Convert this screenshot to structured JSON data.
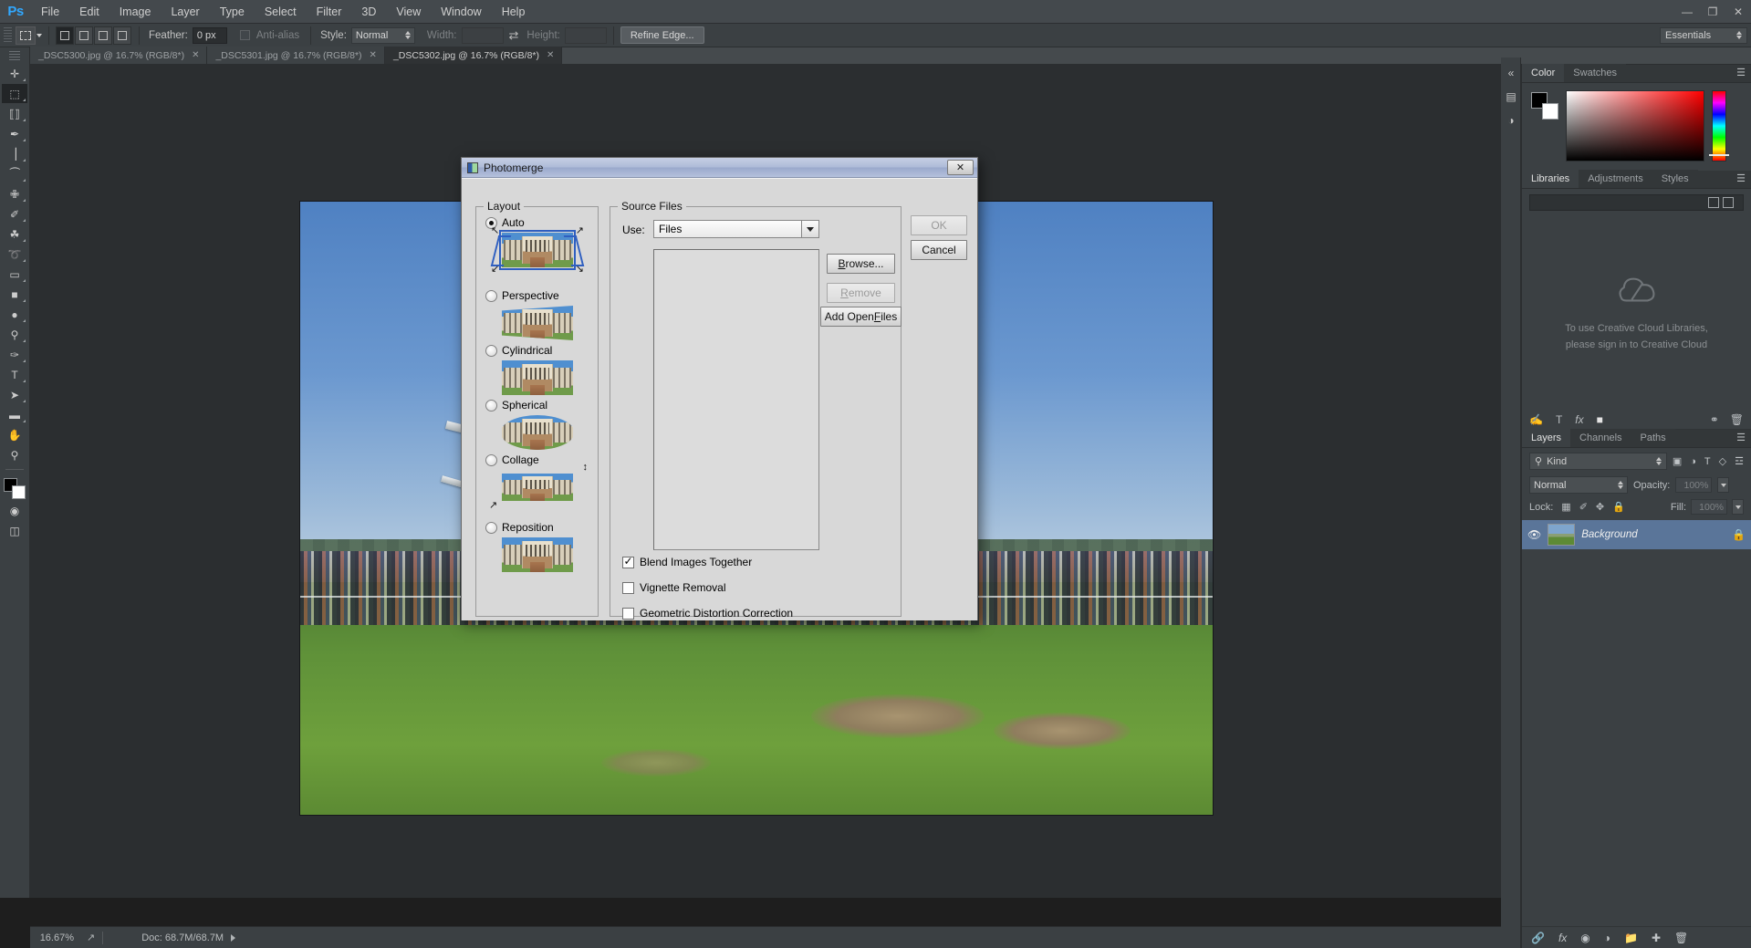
{
  "app": {
    "name": "Ps",
    "logo_color": "#31a8ff"
  },
  "menubar": {
    "items": [
      "File",
      "Edit",
      "Image",
      "Layer",
      "Type",
      "Select",
      "Filter",
      "3D",
      "View",
      "Window",
      "Help"
    ],
    "window_buttons": {
      "minimize": "—",
      "restore": "❐",
      "close": "✕"
    }
  },
  "options_bar": {
    "feather_label": "Feather:",
    "feather_value": "0 px",
    "antialias_label": "Anti-alias",
    "style_label": "Style:",
    "style_value": "Normal",
    "width_label": "Width:",
    "width_value": "",
    "height_label": "Height:",
    "height_value": "",
    "refine_edge_label": "Refine Edge...",
    "workspace_label": "Essentials"
  },
  "tabs": [
    {
      "title": "_DSC5300.jpg @ 16.7% (RGB/8*)",
      "active": false,
      "close": "✕"
    },
    {
      "title": "_DSC5301.jpg @ 16.7% (RGB/8*)",
      "active": false,
      "close": "✕"
    },
    {
      "title": "_DSC5302.jpg @ 16.7% (RGB/8*)",
      "active": true,
      "close": "✕"
    }
  ],
  "toolbar": {
    "tools": [
      {
        "name": "move-tool",
        "glyph": "✛"
      },
      {
        "name": "rectangular-marquee-tool",
        "glyph": "⬚",
        "selected": true
      },
      {
        "name": "lasso-tool",
        "glyph": "❦"
      },
      {
        "name": "quick-selection-tool",
        "glyph": "✒"
      },
      {
        "name": "crop-tool",
        "glyph": "⌗"
      },
      {
        "name": "eyedropper-tool",
        "glyph": "⚗"
      },
      {
        "name": "spot-healing-brush-tool",
        "glyph": "✙"
      },
      {
        "name": "brush-tool",
        "glyph": "✐"
      },
      {
        "name": "clone-stamp-tool",
        "glyph": "⛏"
      },
      {
        "name": "history-brush-tool",
        "glyph": "➰"
      },
      {
        "name": "eraser-tool",
        "glyph": "▭"
      },
      {
        "name": "gradient-tool",
        "glyph": "■"
      },
      {
        "name": "blur-tool",
        "glyph": "●"
      },
      {
        "name": "dodge-tool",
        "glyph": "⚲"
      },
      {
        "name": "pen-tool",
        "glyph": "✑"
      },
      {
        "name": "horizontal-type-tool",
        "glyph": "T"
      },
      {
        "name": "path-selection-tool",
        "glyph": "➤"
      },
      {
        "name": "rectangle-tool",
        "glyph": "▬"
      },
      {
        "name": "hand-tool",
        "glyph": "✋"
      },
      {
        "name": "zoom-tool",
        "glyph": "⚲"
      }
    ],
    "foreground_color": "#000000",
    "background_color": "#ffffff"
  },
  "status_bar": {
    "zoom": "16.67%",
    "doc_label": "Doc: 68.7M/68.7M"
  },
  "color_panel": {
    "tabs": [
      "Color",
      "Swatches"
    ],
    "active_tab": "Color",
    "foreground": "#000000",
    "background": "#ffffff"
  },
  "libraries_panel": {
    "tabs": [
      "Libraries",
      "Adjustments",
      "Styles"
    ],
    "active_tab": "Libraries",
    "search_placeholder": "",
    "message_line1": "To use Creative Cloud Libraries,",
    "message_line2": "please sign in to Creative Cloud"
  },
  "layers_panel": {
    "tabs": [
      "Layers",
      "Channels",
      "Paths"
    ],
    "active_tab": "Layers",
    "filter_label": "Kind",
    "blend_mode": "Normal",
    "opacity_label": "Opacity:",
    "opacity_value": "100%",
    "lock_label": "Lock:",
    "fill_label": "Fill:",
    "fill_value": "100%",
    "layers": [
      {
        "name": "Background",
        "locked": true,
        "visible": true
      }
    ]
  },
  "dialog": {
    "title": "Photomerge",
    "close_label": "✕",
    "layout": {
      "group_title": "Layout",
      "selected": "Auto",
      "options": [
        {
          "label": "Auto",
          "checked": true
        },
        {
          "label": "Perspective",
          "checked": false
        },
        {
          "label": "Cylindrical",
          "checked": false
        },
        {
          "label": "Spherical",
          "checked": false
        },
        {
          "label": "Collage",
          "checked": false
        },
        {
          "label": "Reposition",
          "checked": false
        }
      ]
    },
    "source_files": {
      "group_title": "Source Files",
      "use_label": "Use:",
      "use_value": "Files",
      "file_list": [],
      "buttons": [
        {
          "label": "Browse...",
          "name": "browse-button",
          "disabled": false
        },
        {
          "label": "Remove",
          "name": "remove-button",
          "disabled": true
        },
        {
          "label": "Add Open Files",
          "name": "add-open-files-button",
          "disabled": false
        }
      ]
    },
    "checkboxes": [
      {
        "label": "Blend Images Together",
        "checked": true
      },
      {
        "label": "Vignette Removal",
        "checked": false
      },
      {
        "label": "Geometric Distortion Correction",
        "checked": false
      }
    ],
    "action_buttons": [
      {
        "label": "OK",
        "name": "ok-button",
        "disabled": true
      },
      {
        "label": "Cancel",
        "name": "cancel-button",
        "disabled": false
      }
    ]
  }
}
